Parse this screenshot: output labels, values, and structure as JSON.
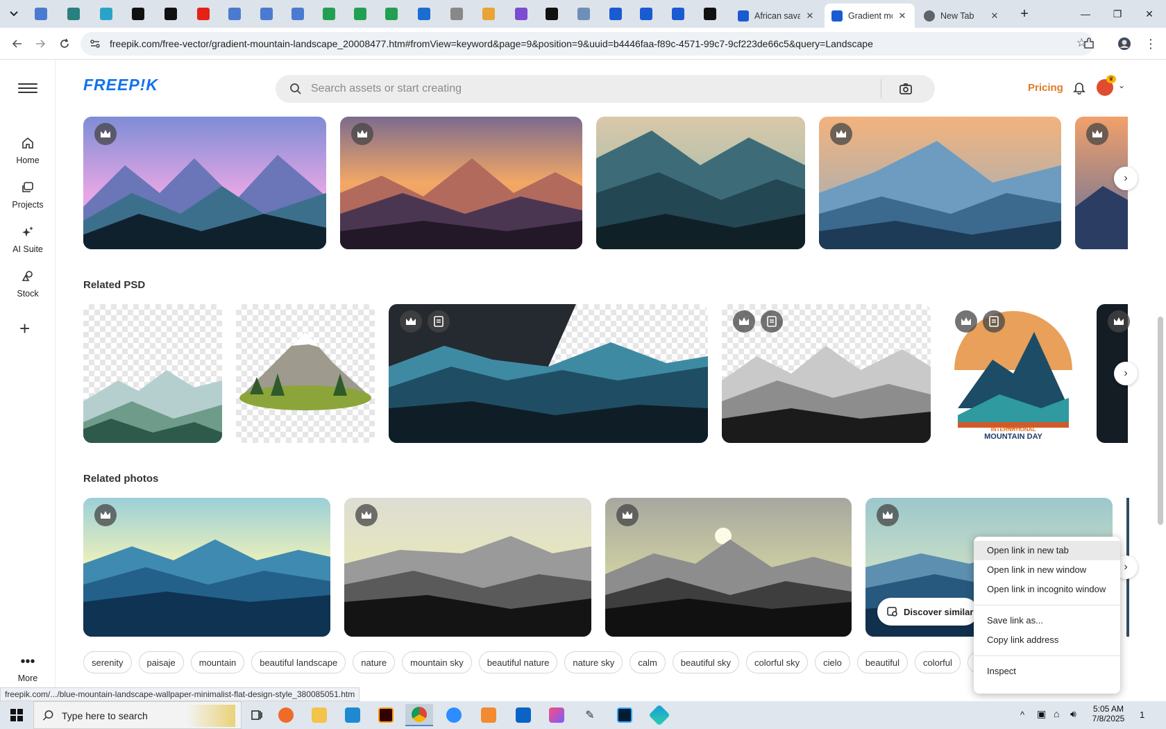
{
  "browser": {
    "pinned_favicon_colors": [
      "#4a7bd1",
      "#2a7f7f",
      "#2ba3c9",
      "#111111",
      "#111111",
      "#e62117",
      "#4a7bd1",
      "#4a7bd1",
      "#4a7bd1",
      "#22a052",
      "#22a052",
      "#22a052",
      "#1a6dd1",
      "#888888",
      "#e8a435",
      "#7c4dd1",
      "#111111",
      "#6f8fb8",
      "#1a5bd1",
      "#1a5bd1",
      "#1a5bd1",
      "#111111"
    ],
    "tabs": [
      {
        "title": "African savan",
        "active": false
      },
      {
        "title": "Gradient mo",
        "active": true
      },
      {
        "title": "New Tab",
        "active": false
      }
    ],
    "url": "freepik.com/free-vector/gradient-mountain-landscape_20008477.htm#fromView=keyword&page=9&position=9&uuid=b4446faa-f89c-4571-99c7-9cf223de66c5&query=Landscape"
  },
  "sidebar": {
    "items": [
      {
        "label": "Home",
        "icon": "home-icon"
      },
      {
        "label": "Projects",
        "icon": "projects-icon"
      },
      {
        "label": "AI Suite",
        "icon": "sparkle-icon"
      },
      {
        "label": "Stock",
        "icon": "stock-icon"
      }
    ],
    "more_label": "More"
  },
  "header": {
    "logo": "FREEP!K",
    "search_placeholder": "Search assets or start creating",
    "pricing_label": "Pricing"
  },
  "sections": {
    "related_psd_title": "Related PSD",
    "related_photos_title": "Related photos"
  },
  "psd_poster_text": {
    "line1": "INTERNATIONAL",
    "line2": "MOUNTAIN DAY"
  },
  "discover_label": "Discover similar",
  "tags": [
    "serenity",
    "paisaje",
    "mountain",
    "beautiful landscape",
    "nature",
    "mountain sky",
    "beautiful nature",
    "nature sky",
    "calm",
    "beautiful sky",
    "colorful sky",
    "cielo",
    "beautiful",
    "colorful",
    "color"
  ],
  "context_menu": {
    "items": [
      "Open link in new tab",
      "Open link in new window",
      "Open link in incognito window",
      "Save link as...",
      "Copy link address",
      "Inspect"
    ]
  },
  "status_url": "freepik.com/.../blue-mountain-landscape-wallpaper-minimalist-flat-design-style_380085051.htm",
  "taskbar": {
    "search_placeholder": "Type here to search",
    "time": "5:05 AM",
    "date": "7/8/2025",
    "notification_count": "1"
  },
  "colors": {
    "brand": "#1273eb",
    "pricing": "#e07b23"
  }
}
